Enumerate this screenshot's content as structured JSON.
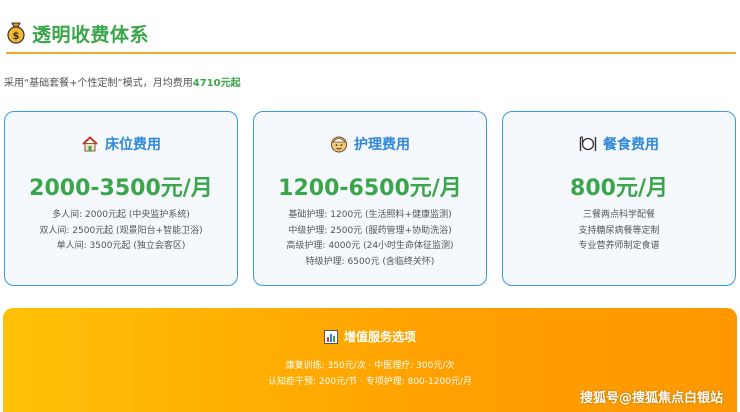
{
  "header": {
    "title": "透明收费体系",
    "icon": "money-bag-icon"
  },
  "intro": {
    "prefix": "采用“基础套餐+个性定制”模式，月均费用",
    "highlight": "4710元起"
  },
  "cards": [
    {
      "icon": "house-icon",
      "title": "床位费用",
      "price": "2000-3500元/月",
      "lines": [
        "多人间: 2000元起 (中央监护系统)",
        "双人间: 2500元起 (观景阳台+智能卫浴)",
        "单人间: 3500元起 (独立会客区)"
      ]
    },
    {
      "icon": "nurse-face-icon",
      "title": "护理费用",
      "price": "1200-6500元/月",
      "lines": [
        "基础护理: 1200元 (生活照料+健康监测)",
        "中级护理: 2500元 (服药管理+协助洗浴)",
        "高级护理: 4000元 (24小时生命体征监测)",
        "特级护理: 6500元 (含临终关怀)"
      ]
    },
    {
      "icon": "plate-cutlery-icon",
      "title": "餐食费用",
      "price": "800元/月",
      "lines": [
        "三餐两点科学配餐",
        "支持糖尿病餐等定制",
        "专业营养师制定食谱"
      ]
    }
  ],
  "extra": {
    "icon": "bar-chart-icon",
    "title": "增值服务选项",
    "lines": [
      "康复训练: 350元/次 · 中医理疗: 300元/次",
      "认知症干预: 200元/节 · 专项护理: 800-1200元/月"
    ]
  },
  "watermark": "搜狐号@搜狐焦点白银站",
  "colors": {
    "green": "#3aa64a",
    "blue": "#2f88d8",
    "orange": "#ffa000"
  }
}
